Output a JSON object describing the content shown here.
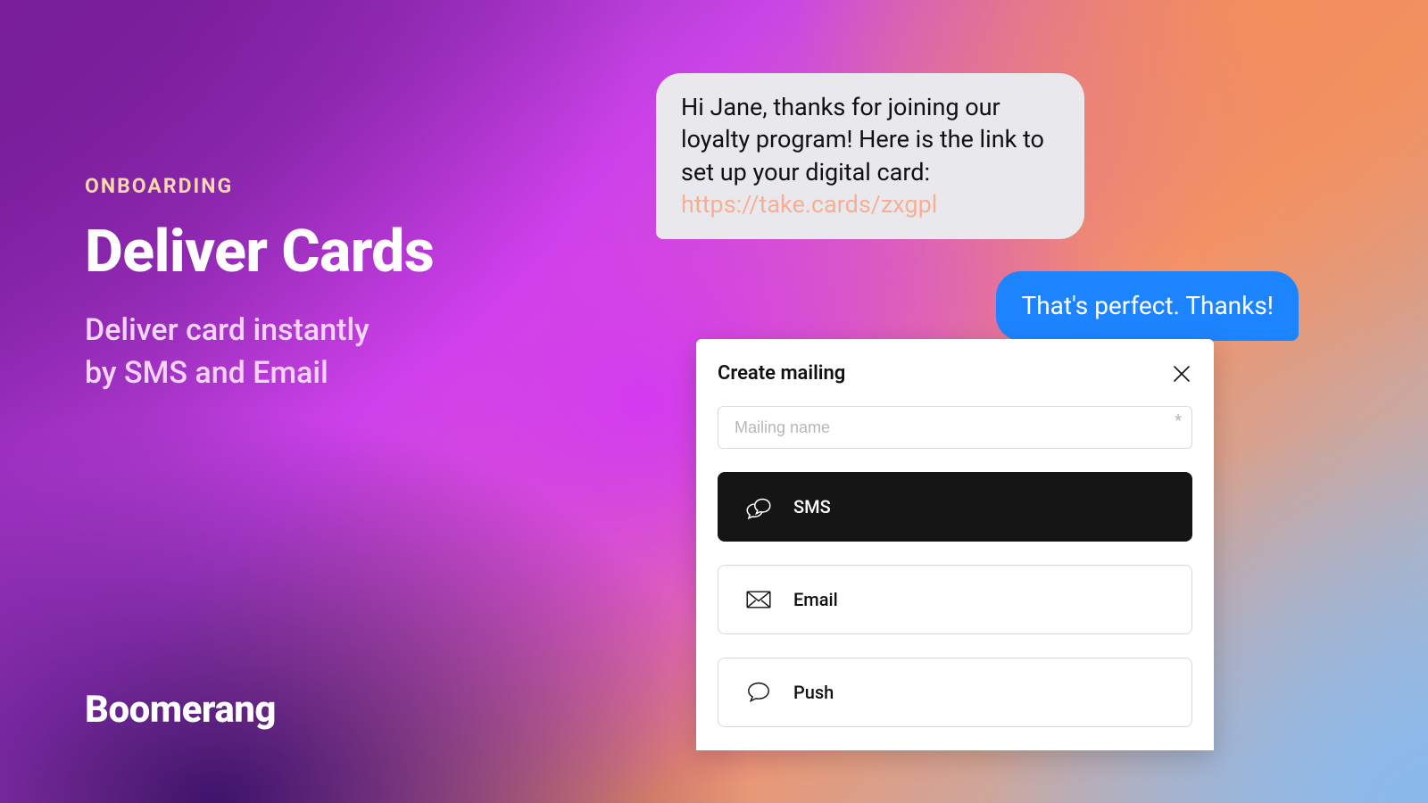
{
  "left": {
    "eyebrow": "ONBOARDING",
    "headline": "Deliver Cards",
    "subhead_line1": "Deliver card instantly",
    "subhead_line2": "by SMS and Email"
  },
  "brand": "Boomerang",
  "chat": {
    "incoming_text": "Hi Jane, thanks for joining our loyalty program! Here is the link to set up your digital card:",
    "incoming_link": "https://take.cards/zxgpl",
    "outgoing_text": "That's perfect. Thanks!"
  },
  "panel": {
    "title": "Create mailing",
    "input_placeholder": "Mailing name",
    "options": {
      "sms": "SMS",
      "email": "Email",
      "push": "Push"
    }
  }
}
